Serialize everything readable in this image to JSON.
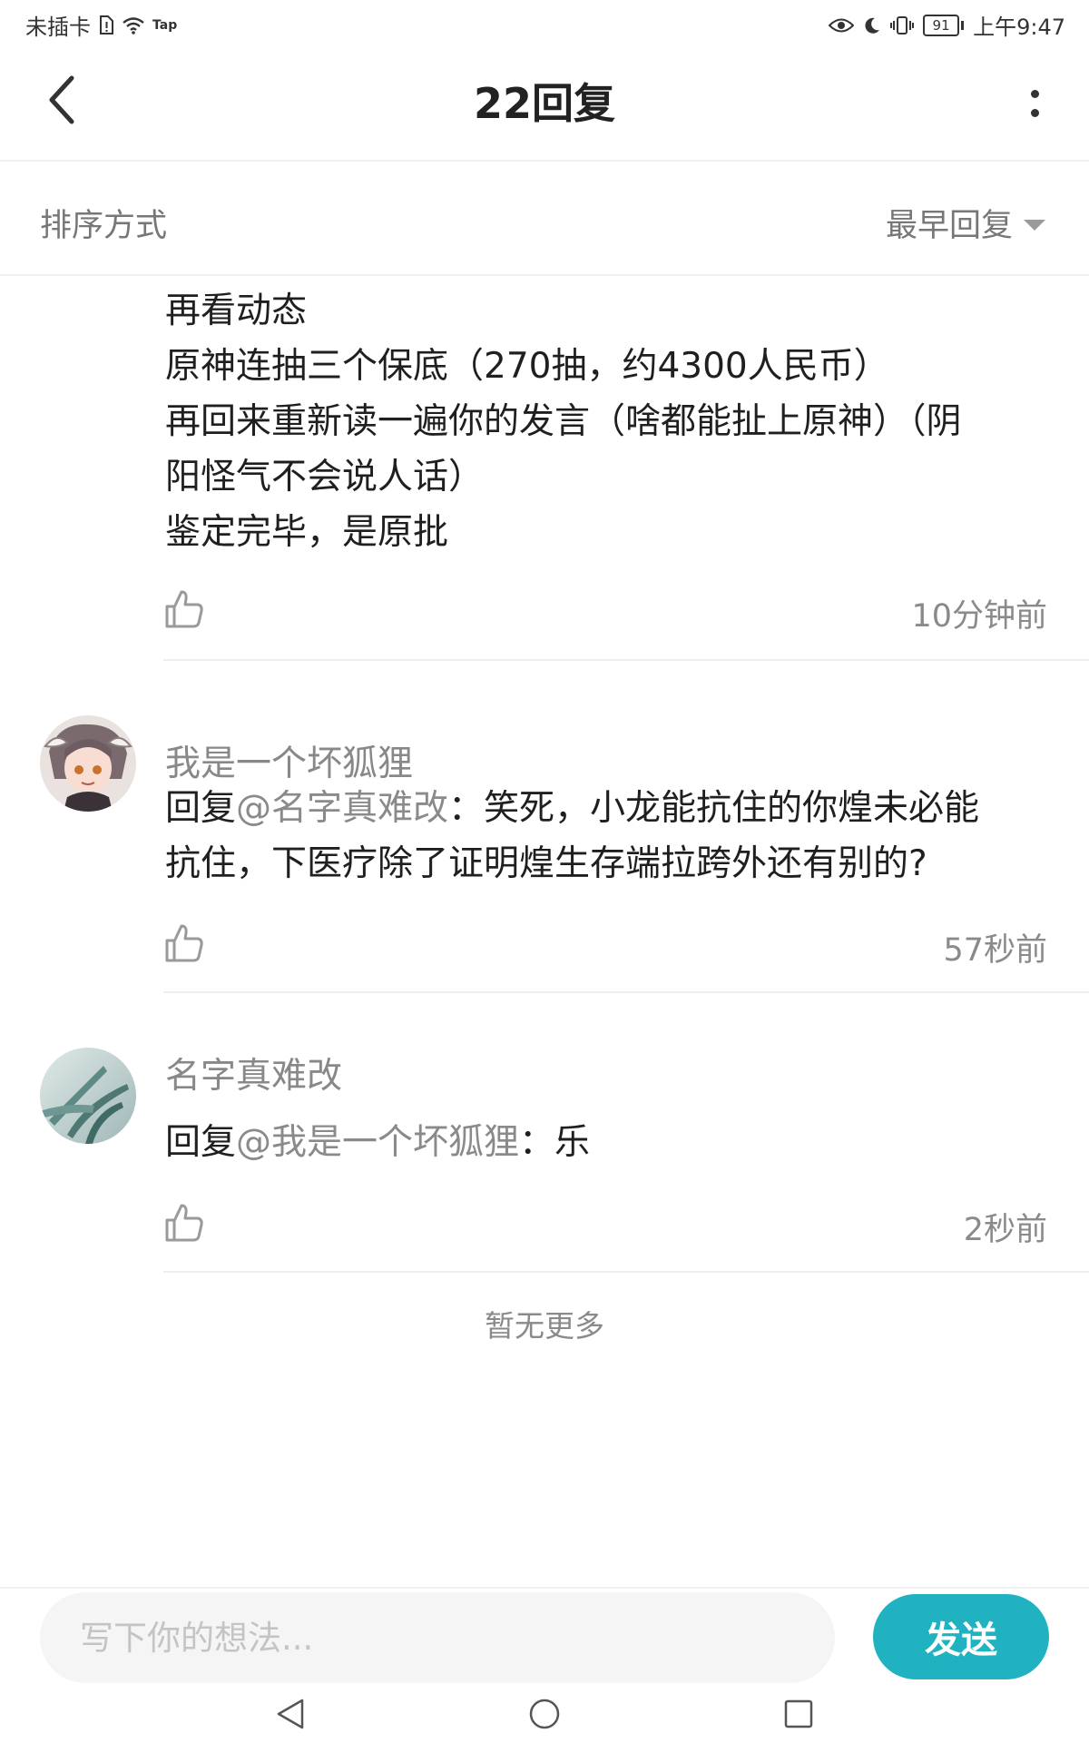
{
  "status_bar": {
    "carrier": "未插卡",
    "tap_label": "Tap",
    "battery": "91",
    "time": "上午9:47"
  },
  "header": {
    "title": "22回复"
  },
  "sort": {
    "label": "排序方式",
    "selected": "最早回复"
  },
  "comments": [
    {
      "lines": [
        "再看动态",
        "原神连抽三个保底（270抽，约4300人民币）",
        "再回来重新读一遍你的发言（啥都能扯上原神）（阴",
        "阳怪气不会说人话）",
        "鉴定完毕，是原批"
      ],
      "time": "10分钟前"
    },
    {
      "name": "我是一个坏狐狸",
      "reply_prefix": "回复",
      "mention": "@名字真难改",
      "text_line1": "：笑死，小龙能抗住的你煌未必能",
      "text_line2": "抗住，下医疗除了证明煌生存端拉跨外还有别的?",
      "time": "57秒前"
    },
    {
      "name": "名字真难改",
      "reply_prefix": "回复",
      "mention": "@我是一个坏狐狸",
      "text_line1": "：乐",
      "time": "2秒前"
    }
  ],
  "no_more": "暂无更多",
  "input": {
    "placeholder": "写下你的想法...",
    "send_label": "发送"
  },
  "colors": {
    "accent": "#21b2c1"
  },
  "icons": {
    "back": "chevron-left-icon",
    "more": "more-vertical-icon",
    "like": "thumbs-up-icon",
    "sort_caret": "caret-down-icon",
    "nav_back": "triangle-back-icon",
    "nav_home": "circle-home-icon",
    "nav_recent": "square-recent-icon"
  }
}
